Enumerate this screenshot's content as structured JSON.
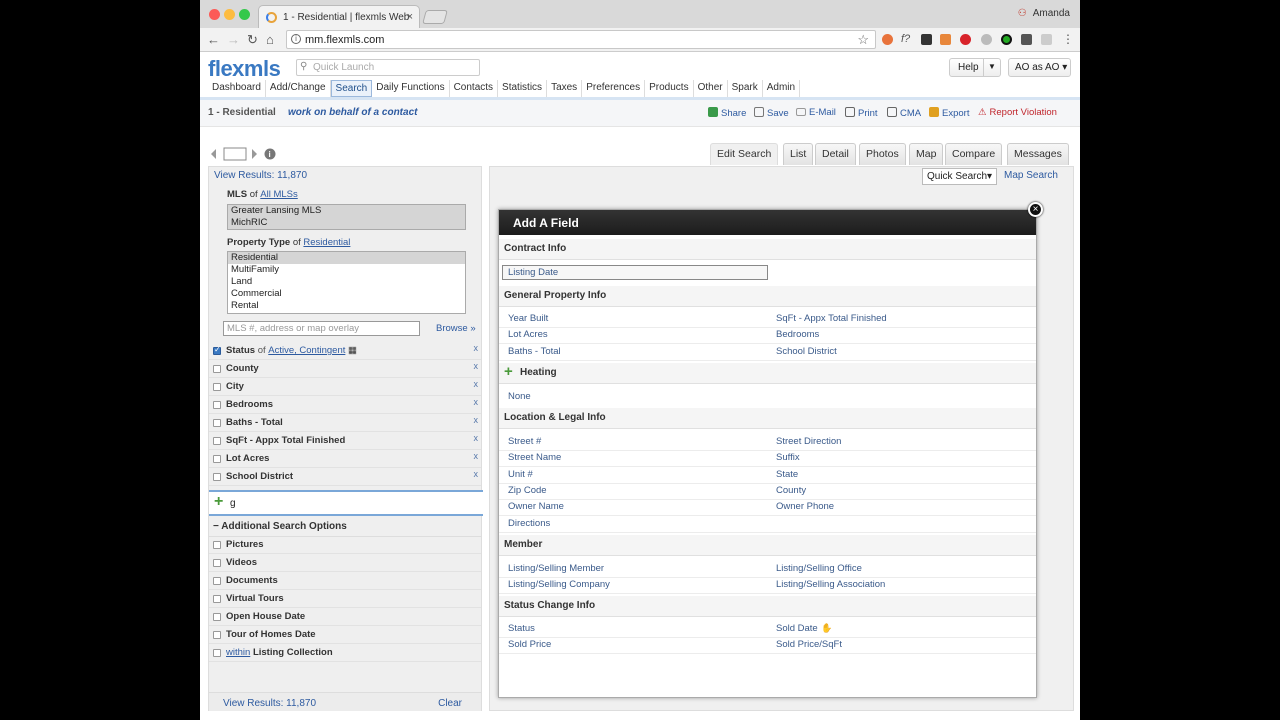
{
  "browser": {
    "tab_title": "1 - Residential | flexmls Web",
    "tab_close": "×",
    "profile_name": "Amanda",
    "url": "mm.flexmls.com"
  },
  "app": {
    "brand": "flexmls",
    "quick_launch_placeholder": "Quick Launch",
    "help_label": "Help",
    "user_label": "AO as AO ▾",
    "nav": [
      "Dashboard",
      "Add/Change",
      "Search",
      "Daily Functions",
      "Contacts",
      "Statistics",
      "Taxes",
      "Preferences",
      "Products",
      "Other",
      "Spark",
      "Admin"
    ],
    "active_nav": "Search"
  },
  "titlebar": {
    "title": "1 - Residential",
    "subtitle": "work on behalf of a contact",
    "actions": [
      "Share",
      "Save",
      "E-Mail",
      "Print",
      "CMA",
      "Export"
    ],
    "report": "Report Violation"
  },
  "view_tabs": [
    "Edit Search",
    "List",
    "Detail",
    "Photos",
    "Map",
    "Compare",
    "Messages"
  ],
  "right_panel": {
    "quick_search": "Quick Search▾",
    "map_search": "Map Search"
  },
  "left_panel": {
    "view_results": "View Results: 11,870",
    "mls_label": "MLS",
    "of": "of",
    "mls_link": "All MLSs",
    "mls_options": [
      "Greater Lansing MLS",
      "MichRIC"
    ],
    "ptype_label": "Property Type",
    "ptype_link": "Residential",
    "ptype_options": [
      "Residential",
      "MultiFamily",
      "Land",
      "Commercial",
      "Rental"
    ],
    "mls_input_placeholder": "MLS #, address or map overlay",
    "browse": "Browse »",
    "status_label": "Status",
    "status_of": "of",
    "status_link": "Active, Contingent",
    "criteria": [
      "County",
      "City",
      "Bedrooms",
      "Baths - Total",
      "SqFt - Appx Total Finished",
      "Lot Acres",
      "School District"
    ],
    "remove_x": "x",
    "add_field_value": "g",
    "additional_label": "Additional Search Options",
    "additional": [
      "Pictures",
      "Videos",
      "Documents",
      "Virtual Tours",
      "Open House Date",
      "Tour of Homes Date"
    ],
    "within_link": "within",
    "within_rest": "Listing Collection",
    "footer_results": "View Results: 11,870",
    "clear": "Clear"
  },
  "modal": {
    "title": "Add A Field",
    "close": "×",
    "contract": {
      "title": "Contract Info",
      "field": "Listing Date"
    },
    "general": {
      "title": "General Property Info",
      "col1": [
        "Year Built",
        "Lot Acres",
        "Baths - Total"
      ],
      "col2": [
        "SqFt - Appx Total Finished",
        "Bedrooms",
        "School District"
      ]
    },
    "heating": {
      "title": "Heating",
      "field": "None"
    },
    "location": {
      "title": "Location & Legal Info",
      "col1": [
        "Street #",
        "Street Name",
        "Unit #",
        "Zip Code",
        "Owner Name",
        "Directions"
      ],
      "col2": [
        "Street Direction",
        "Suffix",
        "State",
        "County",
        "Owner Phone"
      ]
    },
    "member": {
      "title": "Member",
      "col1": [
        "Listing/Selling Member",
        "Listing/Selling Company"
      ],
      "col2": [
        "Listing/Selling Office",
        "Listing/Selling Association"
      ]
    },
    "status": {
      "title": "Status Change Info",
      "col1": [
        "Status",
        "Sold Price"
      ],
      "col2": [
        "Sold Date",
        "Sold Price/SqFt"
      ]
    }
  }
}
